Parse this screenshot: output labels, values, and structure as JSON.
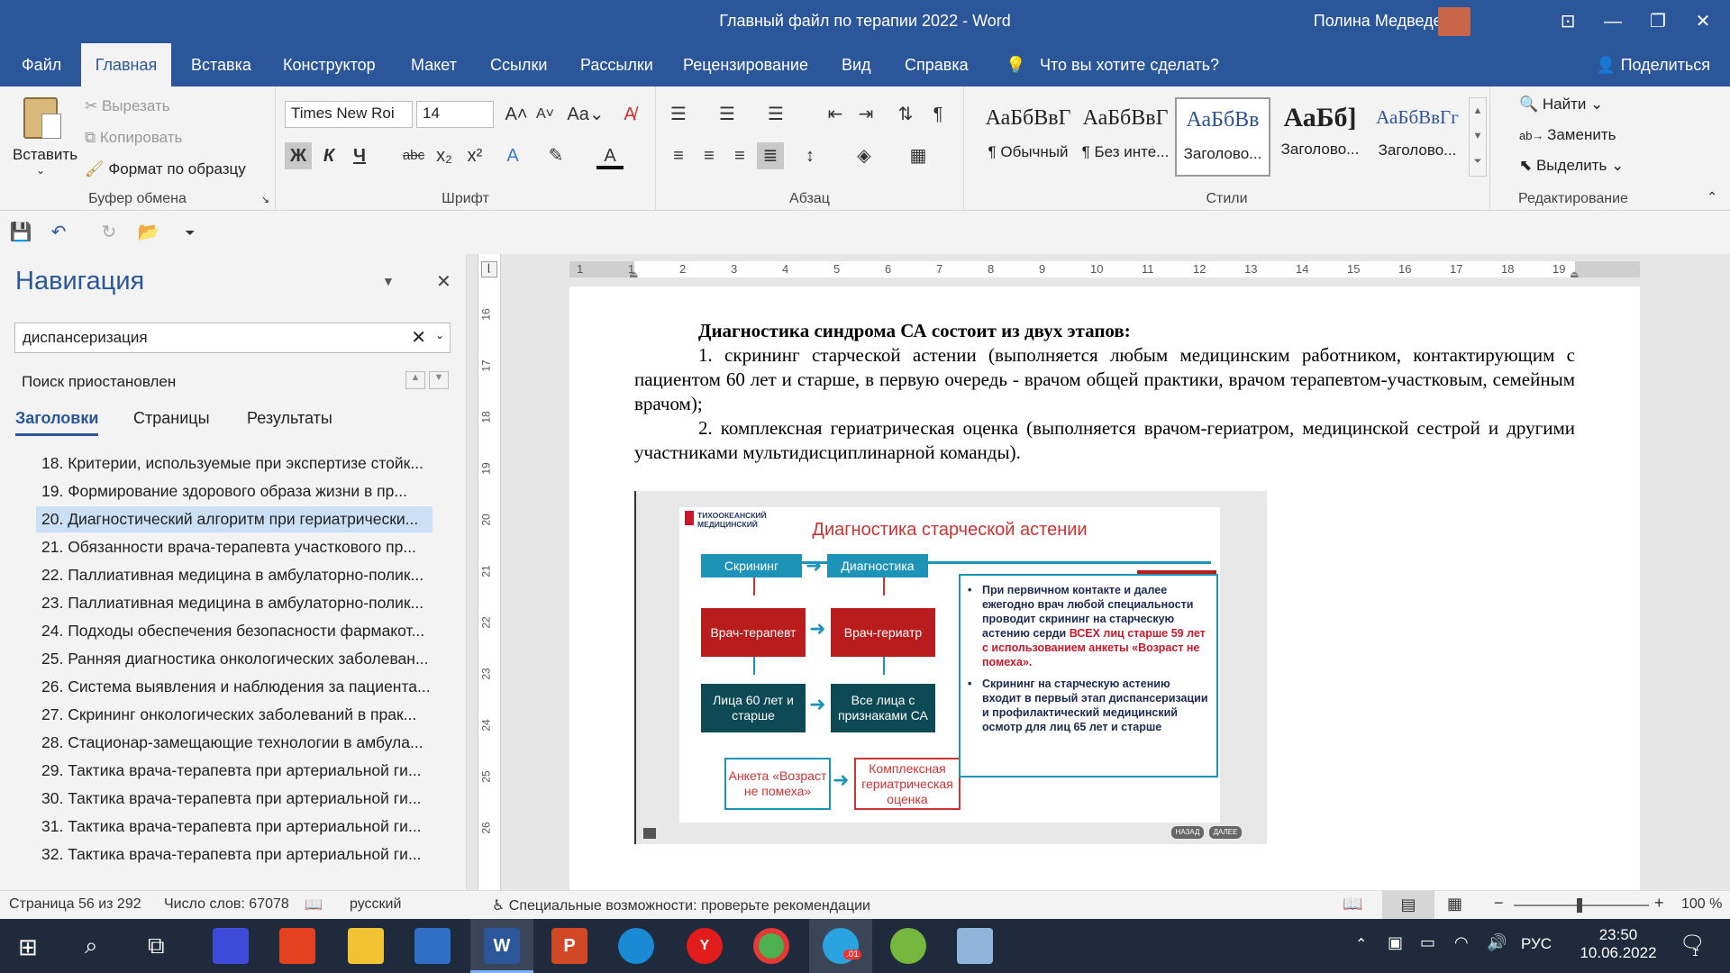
{
  "window": {
    "title": "Главный файл по терапии 2022  -  Word",
    "user": "Полина Медведева"
  },
  "tabs": [
    "Файл",
    "Главная",
    "Вставка",
    "Конструктор",
    "Макет",
    "Ссылки",
    "Рассылки",
    "Рецензирование",
    "Вид",
    "Справка"
  ],
  "tell_me": "Что вы хотите сделать?",
  "share": "Поделиться",
  "clipboard": {
    "paste": "Вставить",
    "cut": "Вырезать",
    "copy": "Копировать",
    "format_painter": "Формат по образцу",
    "label": "Буфер обмена"
  },
  "font": {
    "name": "Times New Roi",
    "size": "14",
    "label": "Шрифт",
    "bold": "Ж",
    "italic": "К",
    "underline": "Ч"
  },
  "paragraph": {
    "label": "Абзац"
  },
  "styles": {
    "label": "Стили",
    "items": [
      {
        "preview": "АаБбВвГ",
        "name": "¶ Обычный"
      },
      {
        "preview": "АаБбВвГ",
        "name": "¶ Без инте..."
      },
      {
        "preview": "АаБбВв",
        "name": "Заголово..."
      },
      {
        "preview": "АаБб]",
        "name": "Заголово..."
      },
      {
        "preview": "АаБбВвГг",
        "name": "Заголово..."
      }
    ]
  },
  "editing": {
    "find": "Найти",
    "replace": "Заменить",
    "select": "Выделить",
    "label": "Редактирование"
  },
  "nav": {
    "title": "Навигация",
    "search": "диспансеризация",
    "status": "Поиск приостановлен",
    "tabs": [
      "Заголовки",
      "Страницы",
      "Результаты"
    ],
    "items": [
      "18. Критерии, используемые при экспертизе стойк...",
      "19. Формирование здорового образа жизни в пр...",
      "20. Диагностический алгоритм при гериатрически...",
      "21. Обязанности врача-терапевта участкового пр...",
      "22. Паллиативная медицина в амбулаторно-полик...",
      "23. Паллиативная медицина в амбулаторно-полик...",
      "24. Подходы обеспечения безопасности фармакот...",
      "25. Ранняя диагностика онкологических заболеван...",
      "26. Система выявления и наблюдения за пациента...",
      "27. Скрининг онкологических заболеваний в прак...",
      "28. Стационар-замещающие технологии в амбула...",
      "29. Тактика врача-терапевта при артериальной ги...",
      "30. Тактика врача-терапевта при артериальной ги...",
      "31. Тактика врача-терапевта при артериальной ги...",
      "32. Тактика врача-терапевта при артериальной ги..."
    ]
  },
  "ruler_numbers": [
    "1",
    "1",
    "2",
    "3",
    "4",
    "5",
    "6",
    "7",
    "8",
    "9",
    "10",
    "11",
    "12",
    "13",
    "14",
    "15",
    "16",
    "17",
    "18",
    "19"
  ],
  "vruler_numbers": [
    "16",
    "17",
    "18",
    "19",
    "20",
    "21",
    "22",
    "23",
    "24",
    "25",
    "26"
  ],
  "doc": {
    "heading": "Диагностика синдрома СА состоит из двух этапов:",
    "p1": "1. скрининг старческой астении (выполняется любым медицинским работником, контактирующим с пациентом 60 лет и старше, в первую очередь - врачом общей практики, врачом терапевтом-участковым, семейным врачом);",
    "p2": "2. комплексная гериатрическая оценка (выполняется врачом-гериатром, медицинской сестрой и другими участниками мультидисциплинарной команды)."
  },
  "slide": {
    "logo": "ТИХООКЕАНСКИЙ МЕДИЦИНСКИЙ",
    "title": "Диагностика старческой астении",
    "screening": "Скрининг",
    "diagnostics": "Диагностика",
    "therapist": "Врач-терапевт",
    "geriatrician": "Врач-гериатр",
    "persons60": "Лица 60 лет и старше",
    "all_sa": "Все лица с признаками СА",
    "questionnaire": "Анкета «Возраст не помеха»",
    "complex": "Комплексная гериатрическая оценка",
    "bullet1_a": "При первичном контакте и далее ежегодно врач любой специальности проводит скрининг на старческую астению серди ",
    "bullet1_b": "ВСЕХ лиц старше 59 лет с использованием анкеты «Возраст не помеха».",
    "bullet2": "Скрининг на старческую астению входит в первый этап диспансеризации и профилактический медицинский осмотр для лиц 65 лет и старше",
    "back": "НАЗАД",
    "next": "ДАЛЕЕ"
  },
  "status": {
    "page": "Страница 56 из 292",
    "words": "Число слов: 67078",
    "lang": "русский",
    "accessibility": "Специальные возможности: проверьте рекомендации",
    "zoom": "100 %"
  },
  "taskbar": {
    "lang": "РУС",
    "time": "23:50",
    "date": "10.06.2022",
    "notif_count": "1",
    "telegram_badge": "01"
  },
  "colors": {
    "word_blue": "#2b579a",
    "teal": "#1d93b8",
    "red": "#b81c1c",
    "dark_teal": "#0e4a56"
  }
}
